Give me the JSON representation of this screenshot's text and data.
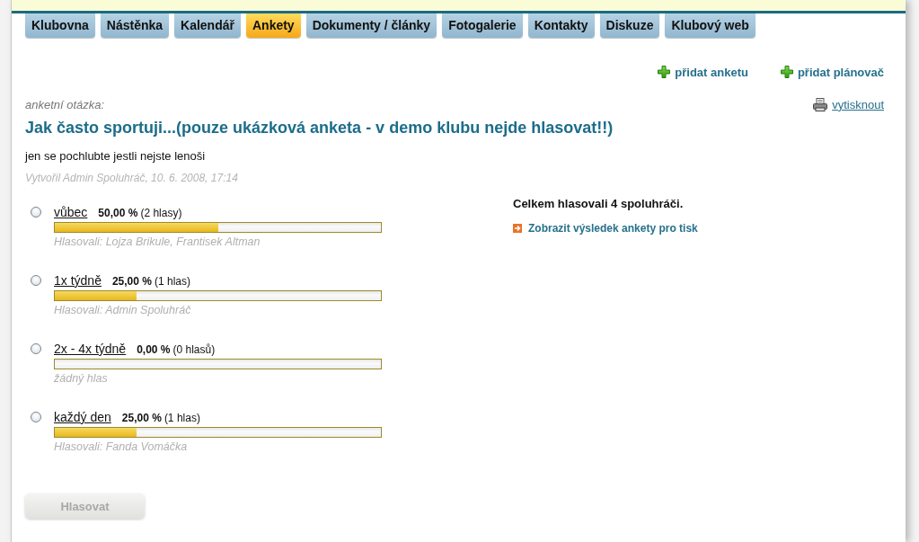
{
  "nav": {
    "tabs": [
      {
        "label": "Klubovna",
        "selected": false
      },
      {
        "label": "Nástěnka",
        "selected": false
      },
      {
        "label": "Kalendář",
        "selected": false
      },
      {
        "label": "Ankety",
        "selected": true
      },
      {
        "label": "Dokumenty / články",
        "selected": false
      },
      {
        "label": "Fotogalerie",
        "selected": false
      },
      {
        "label": "Kontakty",
        "selected": false
      },
      {
        "label": "Diskuze",
        "selected": false
      },
      {
        "label": "Klubový web",
        "selected": false
      }
    ]
  },
  "actions": [
    {
      "label": "přidat anketu"
    },
    {
      "label": "přidat plánovač"
    }
  ],
  "poll": {
    "caption": "anketní otázka:",
    "print_link": "vytisknout",
    "question": "Jak často sportuji...(pouze ukázková anketa - v demo klubu nejde hlasovat!!)",
    "description": "jen se pochlubte jestli nejste lenoši",
    "meta": "Vytvořil Admin Spoluhráč, 10. 6. 2008, 17:14",
    "options": [
      {
        "label": "vůbec",
        "percent": "50,00 %",
        "votes": "(2 hlasy)",
        "level": 0.5,
        "voters": "Hlasovali: Lojza Brikule, Frantisek Altman",
        "selected": false
      },
      {
        "label": "1x týdně",
        "percent": "25,00 %",
        "votes": "(1 hlas)",
        "level": 0.25,
        "voters": "Hlasovali: Admin Spoluhráč",
        "selected": false
      },
      {
        "label": "2x - 4x týdně",
        "percent": "0,00 %",
        "votes": "(0 hlasů)",
        "level": 0,
        "voters": "žádný hlas",
        "selected": false
      },
      {
        "label": "každý den",
        "percent": "25,00 %",
        "votes": "(1 hlas)",
        "level": 0.25,
        "voters": "Hlasovali: Fanda Vomáčka",
        "selected": false
      }
    ]
  },
  "summary": {
    "total": "Celkem hlasovali 4 spoluhráči.",
    "link": "Zobrazit výsledek ankety pro tisk"
  },
  "vote_button": {
    "label": "Hlasovat",
    "disabled": true
  }
}
